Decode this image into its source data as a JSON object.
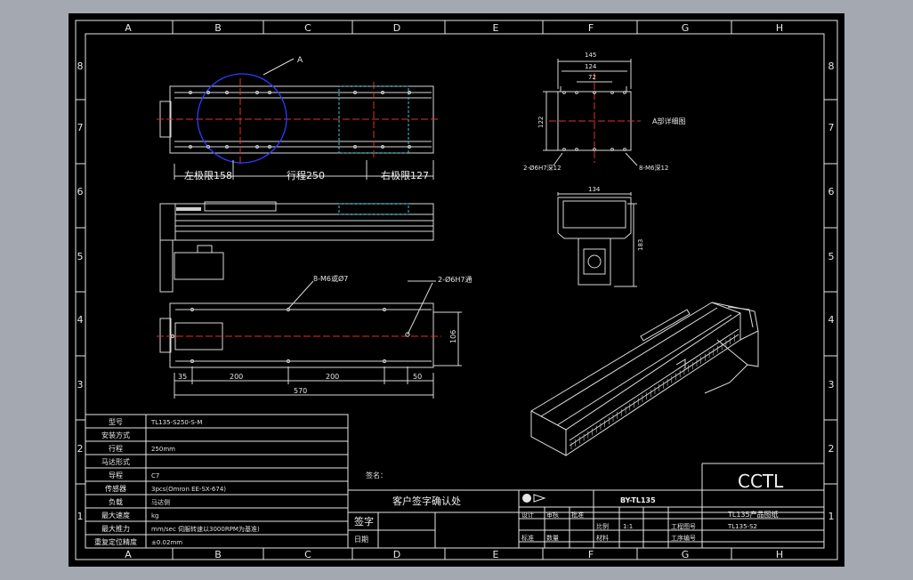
{
  "frame": {
    "columns": [
      "A",
      "B",
      "C",
      "D",
      "E",
      "F",
      "G",
      "H"
    ],
    "rows": [
      "8",
      "7",
      "6",
      "5",
      "4",
      "3",
      "2",
      "1"
    ]
  },
  "top_view": {
    "callout": "A",
    "dim_left": "左极限158",
    "dim_stroke": "行程250",
    "dim_right": "右极限127"
  },
  "bottom_view": {
    "note_holes": "8-M6或Ø7",
    "note_pins": "2-Ø6H7通",
    "dims": [
      "35",
      "200",
      "200",
      "50"
    ],
    "total": "570",
    "height": "106"
  },
  "detail_view": {
    "widths": [
      "145",
      "124",
      "72"
    ],
    "height": "122",
    "label": "A部详细图",
    "note_pin": "2-Ø6H7深12",
    "note_tap": "8-M6深12"
  },
  "end_view": {
    "width": "134",
    "height": "183"
  },
  "spec_table": [
    {
      "label": "型号",
      "value": "TL135-S250-S-M"
    },
    {
      "label": "安装方式",
      "value": ""
    },
    {
      "label": "行程",
      "value": "250mm"
    },
    {
      "label": "马达形式",
      "value": ""
    },
    {
      "label": "导程",
      "value": "C7"
    },
    {
      "label": "传感器",
      "value": "3pcs(Omron EE-SX-674)"
    },
    {
      "label": "负载",
      "value": "马达侧"
    },
    {
      "label": "最大速度",
      "value": "kg"
    },
    {
      "label": "最大推力",
      "value": "mm/sec 伺服转速以3000RPM为基准)"
    },
    {
      "label": "重复定位精度",
      "value": "±0.02mm"
    }
  ],
  "title_block": {
    "signature_note": "签名：",
    "customer_confirm": "客户签字确认处",
    "sign_label": "签字",
    "date_label": "日期",
    "drawing_no": "BY-TL135",
    "product_name": "TL135产品图纸",
    "logo": "CCTL",
    "part_code": "TL135-S2",
    "cells": [
      "设计",
      "审核",
      "批准",
      "比例",
      "1:1",
      "工程图号",
      "标准",
      "数量",
      "材料",
      "工序编号"
    ]
  }
}
